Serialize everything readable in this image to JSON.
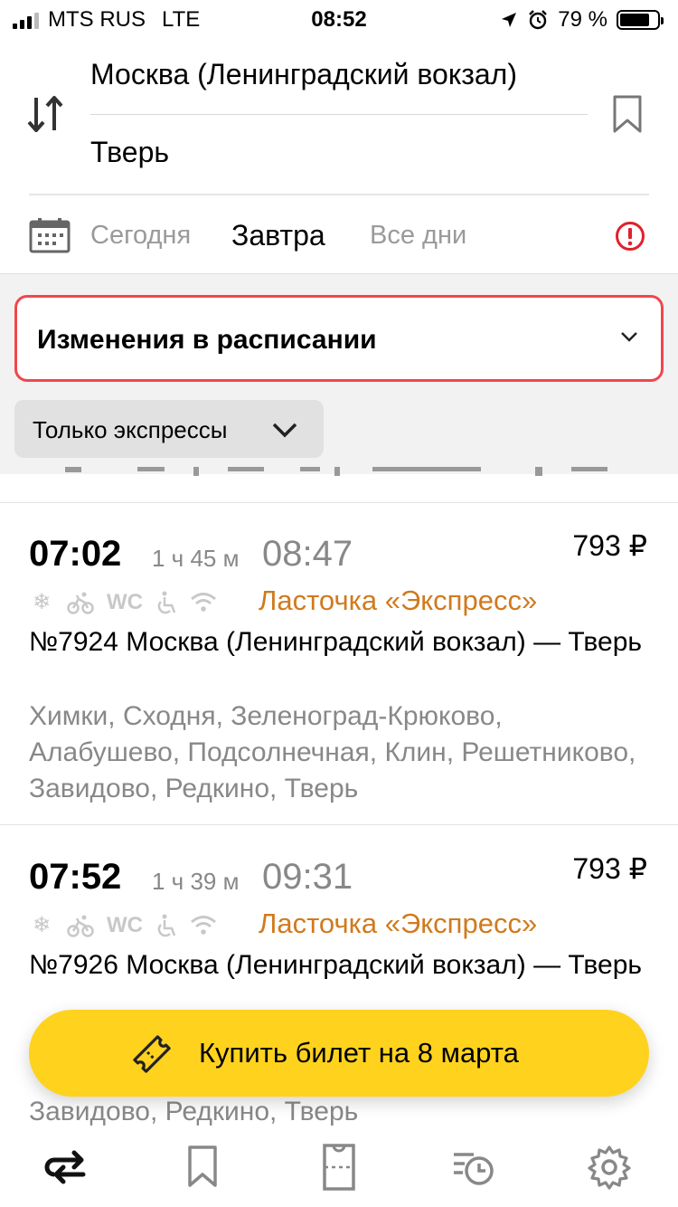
{
  "status_bar": {
    "carrier": "MTS RUS",
    "network": "LTE",
    "time": "08:52",
    "battery": "79 %",
    "battery_level": 0.79
  },
  "route": {
    "from": "Москва (Ленинградский вокзал)",
    "to": "Тверь"
  },
  "days": {
    "today": "Сегодня",
    "tomorrow": "Завтра",
    "all": "Все дни",
    "selected": "tomorrow"
  },
  "schedule_changes": {
    "label": "Изменения в расписании"
  },
  "filter": {
    "label": "Только экспрессы"
  },
  "trips": [
    {
      "departure": "07:02",
      "duration": "1 ч 45 м",
      "arrival": "08:47",
      "price": "793 ₽",
      "train_type": "Ласточка «Экспресс»",
      "title": "№7924 Москва (Ленинградский вокзал) — Тверь",
      "stops": "Химки, Сходня, Зеленоград-Крюково, Алабушево, Подсолнечная, Клин, Решетниково, Завидово, Редкино, Тверь",
      "amenity_wc": "WC"
    },
    {
      "departure": "07:52",
      "duration": "1 ч 39 м",
      "arrival": "09:31",
      "price": "793 ₽",
      "train_type": "Ласточка «Экспресс»",
      "title": "№7926 Москва (Ленинградский вокзал) — Тверь",
      "stops": "Завидово, Редкино, Тверь",
      "amenity_wc": "WC"
    }
  ],
  "buy_button": {
    "label": "Купить билет на 8 марта"
  },
  "colors": {
    "accent_yellow": "#ffd21e",
    "train_type_orange": "#d07a1d",
    "alert_red": "#e0212c",
    "card_border_red": "#f0474d"
  },
  "tabbar": {
    "items": [
      "routes-icon",
      "bookmark-icon",
      "tickets-icon",
      "history-icon",
      "settings-icon"
    ]
  }
}
